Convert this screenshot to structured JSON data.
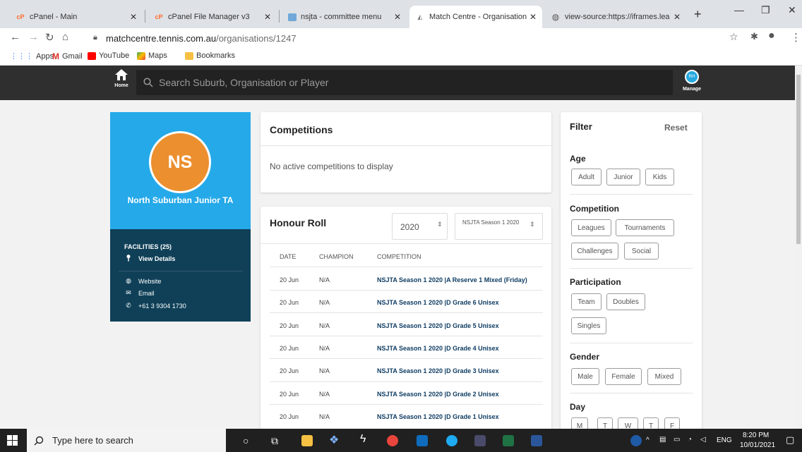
{
  "browser": {
    "tabs": [
      {
        "title": "cPanel - Main",
        "icon": "cpanel-icon"
      },
      {
        "title": "cPanel File Manager v3",
        "icon": "cpanel-icon"
      },
      {
        "title": "nsjta - committee menu",
        "icon": "folder-icon"
      },
      {
        "title": "Match Centre - Organisation P",
        "icon": "tennis-icon"
      },
      {
        "title": "view-source:https://iframes.lea",
        "icon": "globe-icon"
      }
    ],
    "url_host": "matchcentre.tennis.com.au",
    "url_path": "/organisations/1247",
    "bookmarks": [
      "Apps",
      "Gmail",
      "YouTube",
      "Maps",
      "Bookmarks"
    ]
  },
  "header": {
    "home_label": "Home",
    "search_placeholder": "Search Suburb, Organisation or Player",
    "manage_label": "Manage",
    "avatar_initials": "RH"
  },
  "profile": {
    "initials": "NS",
    "name": "North Suburban Junior TA",
    "facilities": "FACILITIES (25)",
    "view_details": "View Details",
    "website": "Website",
    "email": "Email",
    "phone": "+61 3 9304 1730",
    "accent_color": "#25a9e9",
    "avatar_color": "#ec8f2e",
    "info_bg": "#0f4058"
  },
  "competitions": {
    "title": "Competitions",
    "empty_text": "No active competitions to display"
  },
  "honour_roll": {
    "title": "Honour Roll",
    "year": "2020",
    "season": "NSJTA Season 1 2020",
    "columns": [
      "DATE",
      "CHAMPION",
      "COMPETITION"
    ],
    "rows": [
      {
        "date": "20 Jun",
        "champion": "N/A",
        "competition": "NSJTA Season 1 2020 |A Reserve 1 Mixed (Friday)"
      },
      {
        "date": "20 Jun",
        "champion": "N/A",
        "competition": "NSJTA Season 1 2020 |D Grade 6 Unisex"
      },
      {
        "date": "20 Jun",
        "champion": "N/A",
        "competition": "NSJTA Season 1 2020 |D Grade 5 Unisex"
      },
      {
        "date": "20 Jun",
        "champion": "N/A",
        "competition": "NSJTA Season 1 2020 |D Grade 4 Unisex"
      },
      {
        "date": "20 Jun",
        "champion": "N/A",
        "competition": "NSJTA Season 1 2020 |D Grade 3 Unisex"
      },
      {
        "date": "20 Jun",
        "champion": "N/A",
        "competition": "NSJTA Season 1 2020 |D Grade 2 Unisex"
      },
      {
        "date": "20 Jun",
        "champion": "N/A",
        "competition": "NSJTA Season 1 2020 |D Grade 1 Unisex"
      }
    ]
  },
  "filter": {
    "title": "Filter",
    "reset": "Reset",
    "age": {
      "label": "Age",
      "options": [
        "Adult",
        "Junior",
        "Kids"
      ]
    },
    "competition": {
      "label": "Competition",
      "options": [
        "Leagues",
        "Tournaments",
        "Challenges",
        "Social"
      ]
    },
    "participation": {
      "label": "Participation",
      "options": [
        "Team",
        "Doubles",
        "Singles"
      ]
    },
    "gender": {
      "label": "Gender",
      "options": [
        "Male",
        "Female",
        "Mixed"
      ]
    },
    "day": {
      "label": "Day",
      "options": [
        "M",
        "T",
        "W",
        "T",
        "F"
      ]
    }
  },
  "taskbar": {
    "search_placeholder": "Type here to search",
    "language": "ENG",
    "time": "8:20 PM",
    "date": "10/01/2021"
  }
}
